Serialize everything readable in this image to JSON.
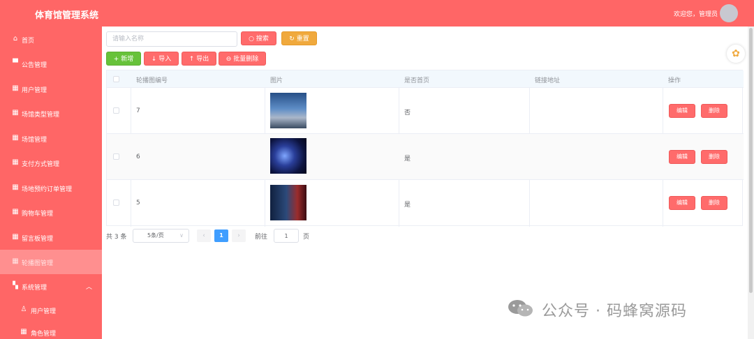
{
  "header": {
    "app_title": "体育馆管理系统",
    "welcome": "欢迎您，管理员",
    "bg_color": "#ff6666"
  },
  "sidebar": {
    "items": [
      {
        "label": "首页",
        "icon": "home-icon"
      },
      {
        "label": "公告管理",
        "icon": "message-icon"
      },
      {
        "label": "用户管理",
        "icon": "grid-icon"
      },
      {
        "label": "场馆类型管理",
        "icon": "grid-icon"
      },
      {
        "label": "场馆管理",
        "icon": "grid-icon"
      },
      {
        "label": "支付方式管理",
        "icon": "grid-icon"
      },
      {
        "label": "场地预约订单管理",
        "icon": "grid-icon"
      },
      {
        "label": "购物车管理",
        "icon": "grid-icon"
      },
      {
        "label": "留言板管理",
        "icon": "grid-icon"
      },
      {
        "label": "轮播图管理",
        "icon": "grid-icon",
        "active": true
      },
      {
        "label": "系统管理",
        "icon": "apps-icon",
        "expanded": true
      },
      {
        "label": "用户管理",
        "icon": "user-icon",
        "sub": true
      },
      {
        "label": "角色管理",
        "icon": "grid-icon",
        "sub": true
      }
    ]
  },
  "toolbar": {
    "search_placeholder": "请输入名称",
    "search_value": "",
    "search_label": "搜索",
    "reset_label": "重置",
    "add_label": "新增",
    "import_label": "导入",
    "export_label": "导出",
    "batch_delete_label": "批量删除"
  },
  "table": {
    "headers": [
      "轮播图编号",
      "图片",
      "是否首页",
      "链接地址",
      "操作"
    ],
    "rows": [
      {
        "id": "7",
        "is_home": "否",
        "link": ""
      },
      {
        "id": "6",
        "is_home": "是",
        "link": ""
      },
      {
        "id": "5",
        "is_home": "是",
        "link": ""
      }
    ],
    "edit_label": "编辑",
    "delete_label": "删除"
  },
  "pagination": {
    "total": "共 3 条",
    "page_size": "5条/页",
    "current_page": "1",
    "goto_prefix": "前往",
    "goto_value": "1",
    "goto_suffix": "页"
  },
  "watermark": {
    "text": "公众号 · 码蜂窝源码"
  }
}
